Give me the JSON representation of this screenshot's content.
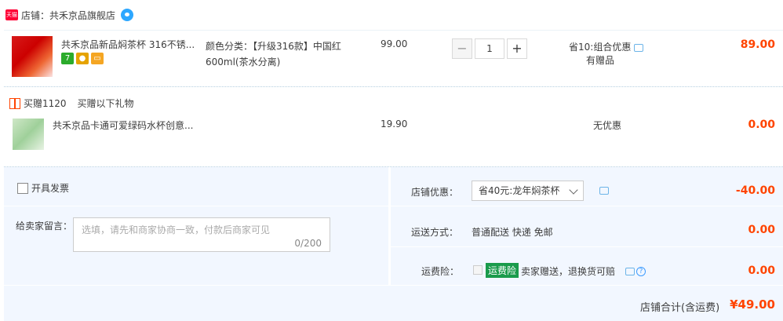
{
  "shop": {
    "badge": "天猫",
    "label": "店铺：",
    "name": "共禾京品旗舰店"
  },
  "items": [
    {
      "title": "共禾京品新品焖茶杯 316不锈...",
      "sku": "颜色分类：【升级316款】中国红600ml(茶水分离)",
      "price": "99.00",
      "qty": "1",
      "promo": "省10:组合优惠",
      "promo_sub": "有赠品",
      "total": "89.00"
    }
  ],
  "gift": {
    "head": "买赠1120",
    "subhead": "买赠以下礼物",
    "title": "共禾京品卡通可爱绿码水杯创意...",
    "price": "19.90",
    "promo": "无优惠",
    "total": "0.00"
  },
  "summary": {
    "invoice_label": "开具发票",
    "message_label": "给卖家留言：",
    "message_placeholder": "选填，请先和商家协商一致，付款后商家可见",
    "message_count": "0/200",
    "shop_discount_label": "店铺优惠：",
    "shop_discount_select": "省40元:龙年焖茶杯",
    "shop_discount_value": "-40.00",
    "shipping_label": "运送方式：",
    "shipping_text": "普通配送 快递 免邮",
    "shipping_value": "0.00",
    "insurance_label": "运费险：",
    "insurance_tag": "运费险",
    "insurance_text": "卖家赠送，退换货可赔",
    "insurance_value": "0.00",
    "total_label": "店铺合计(含运费)",
    "total_value": "¥49.00"
  },
  "colors": {
    "accent": "#ff4400",
    "summary_bg": "#f2f7ff",
    "insurance_tag": "#1a9b4b"
  }
}
